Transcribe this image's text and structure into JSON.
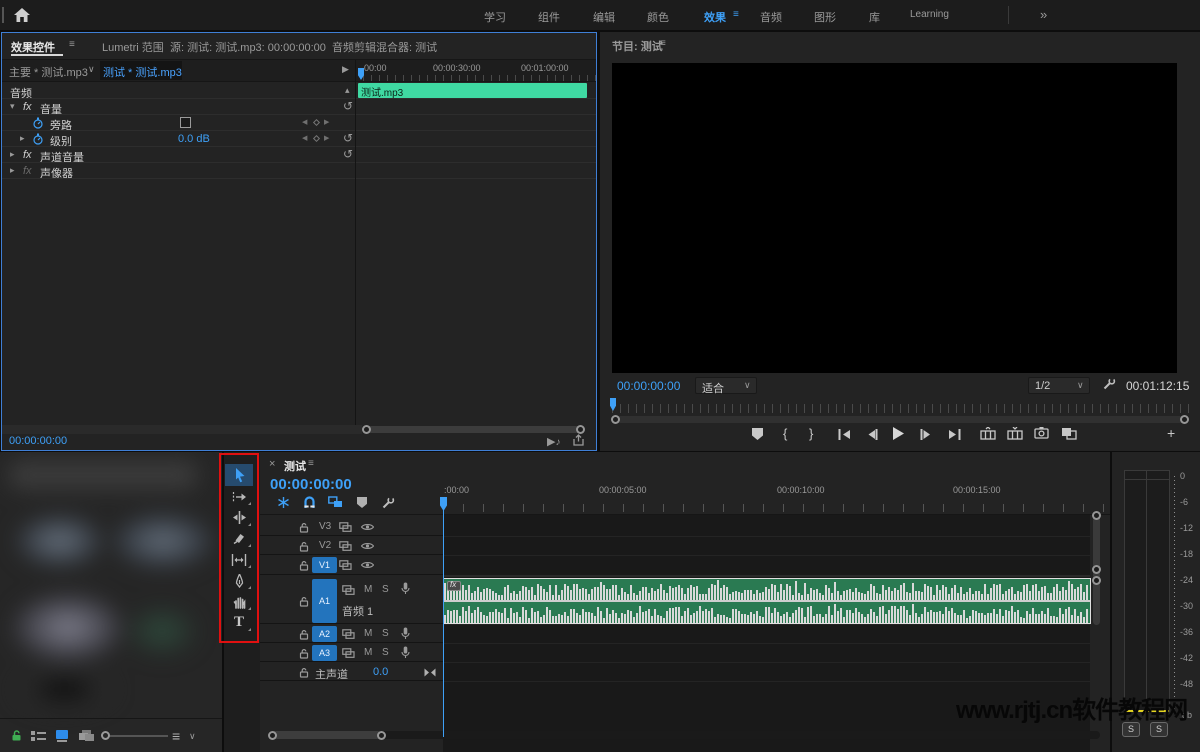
{
  "colors": {
    "accent_blue": "#2d8ceb",
    "timecode_blue": "#3ea0f7",
    "badge_blue": "#2374bd",
    "source_clip_green": "#3fd9a2",
    "timeline_clip_green": "#2a7a52",
    "waveform_gray": "#d9d9d9",
    "highlight_red": "#e01010",
    "meter_yellow": "#e3d320",
    "lock_green": "#3fae53"
  },
  "icons": {
    "menu": "≡",
    "overflow": "»",
    "chevron_down": "∨",
    "collapse_up": "▴",
    "expand_right": "▸",
    "expanded_down": "▾",
    "reset": "↺",
    "nav_left": "◀",
    "nav_right": "▶",
    "play": "▶",
    "note": "♪",
    "plus": "+",
    "mark_in": "{",
    "mark_out": "}",
    "close": "×",
    "panel_arrow": "▶"
  },
  "menubar": {
    "items": [
      "学习",
      "组件",
      "编辑",
      "颜色",
      "效果",
      "音频",
      "图形",
      "库",
      "Learning"
    ],
    "active": "效果",
    "overflow": "»"
  },
  "effect_controls": {
    "tabs": [
      "效果控件",
      "Lumetri 范围",
      "源: 测试: 测试.mp3: 00:00:00:00",
      "音频剪辑混合器: 测试"
    ],
    "clip_selector": {
      "master": "主要 * 测试.mp3",
      "clip": "测试 * 测试.mp3"
    },
    "mini_ruler": [
      "00:00",
      "00:00:30:00",
      "00:01:00:00"
    ],
    "source_clip": "测试.mp3",
    "section_audio": "音频",
    "fx": "fx",
    "volume": "音量",
    "bypass": "旁路",
    "level": "级别",
    "level_value": "0.0 dB",
    "channel_volume": "声道音量",
    "panner": "声像器",
    "timecode": "00:00:00:00"
  },
  "program": {
    "tab": "节目: 测试",
    "timecode": "00:00:00:00",
    "fit": "适合",
    "zoom": "1/2",
    "duration": "00:01:12:15"
  },
  "timeline": {
    "tab": "测试",
    "timecode": "00:00:00:00",
    "ruler": [
      ":00:00",
      "00:00:05:00",
      "00:00:10:00",
      "00:00:15:00"
    ],
    "video_tracks": [
      "V3",
      "V2",
      "V1"
    ],
    "audio_tracks": [
      "A1",
      "A2",
      "A3"
    ],
    "audio_label": "音频 1",
    "master_label": "主声道",
    "master_value": "0.0",
    "mute": "M",
    "solo": "S",
    "clip_fx": "fx"
  },
  "meters": {
    "ticks": [
      "0",
      "-6",
      "-12",
      "-18",
      "-24",
      "-30",
      "-36",
      "-42",
      "-48"
    ],
    "unit": "db",
    "solo": "S"
  },
  "watermark": "www.rjtj.cn软件教程网"
}
